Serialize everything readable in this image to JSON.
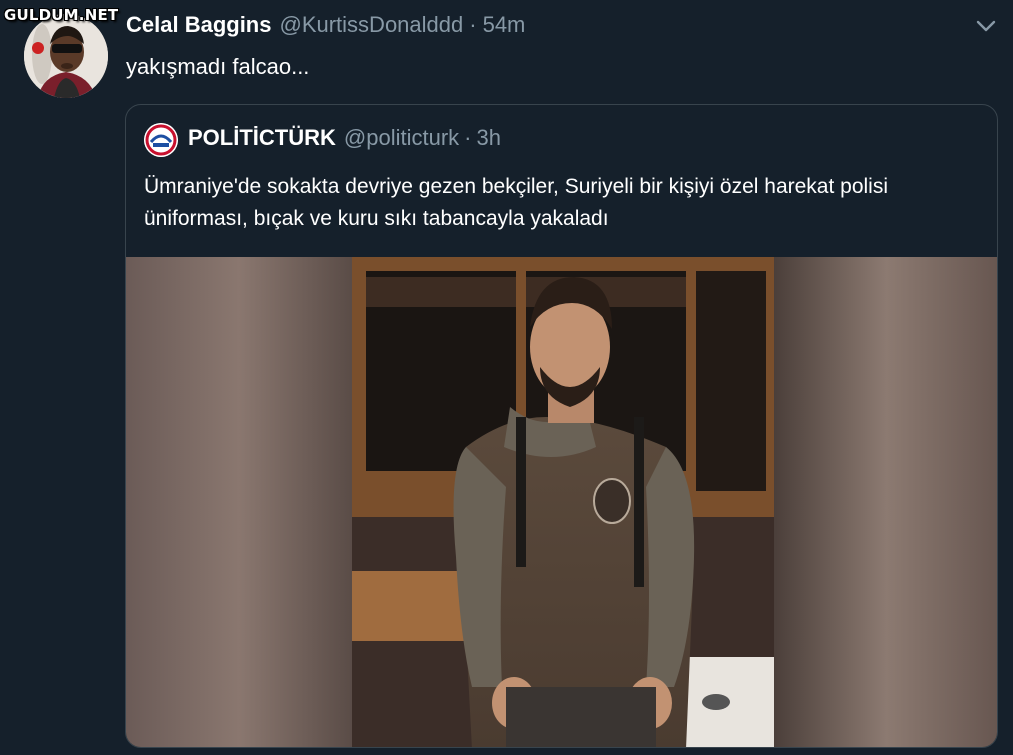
{
  "watermark": "GULDUM.NET",
  "tweet": {
    "display_name": "Celal Baggins",
    "handle": "@KurtissDonalddd",
    "separator": "·",
    "time": "54m",
    "text": "yakışmadı falcao...",
    "menu_icon": "chevron-down-icon"
  },
  "quoted_tweet": {
    "display_name": "POLİTİCTÜRK",
    "handle": "@politicturk",
    "separator": "·",
    "time": "3h",
    "text": "Ümraniye'de sokakta devriye gezen bekçiler, Suriyeli bir kişiyi özel harekat polisi üniforması, bıçak ve kuru sıkı tabancayla yakaladı",
    "media_alt": "photo"
  },
  "colors": {
    "background": "#15202b",
    "border": "#38444d",
    "secondary_text": "#8899a6",
    "primary_text": "#ffffff"
  }
}
